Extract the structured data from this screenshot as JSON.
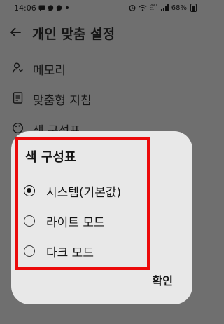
{
  "status_bar": {
    "time": "14:06",
    "left_icons": [
      "sms-icon",
      "chat-icon",
      "chat-icon",
      "dot-icon"
    ],
    "right_icons": [
      "alarm-icon",
      "wifi-icon",
      "volte-icon",
      "signal-icon"
    ],
    "network_label": "VoLTE1",
    "battery": "68%"
  },
  "header": {
    "title": "개인 맞춤 설정"
  },
  "menu": {
    "items": [
      {
        "label": "메모리",
        "icon": "memory-icon"
      },
      {
        "label": "맞춤형 지침",
        "icon": "instructions-icon"
      },
      {
        "label": "색 구성표",
        "icon": "palette-icon"
      }
    ]
  },
  "dialog": {
    "title": "색 구성표",
    "options": [
      {
        "label": "시스템(기본값)",
        "selected": true
      },
      {
        "label": "라이트 모드",
        "selected": false
      },
      {
        "label": "다크 모드",
        "selected": false
      }
    ],
    "confirm_label": "확인"
  },
  "colors": {
    "scrim_background": "#6f6f6f",
    "dialog_background": "#e8e8e8",
    "highlight_border": "#ec0b0b"
  }
}
